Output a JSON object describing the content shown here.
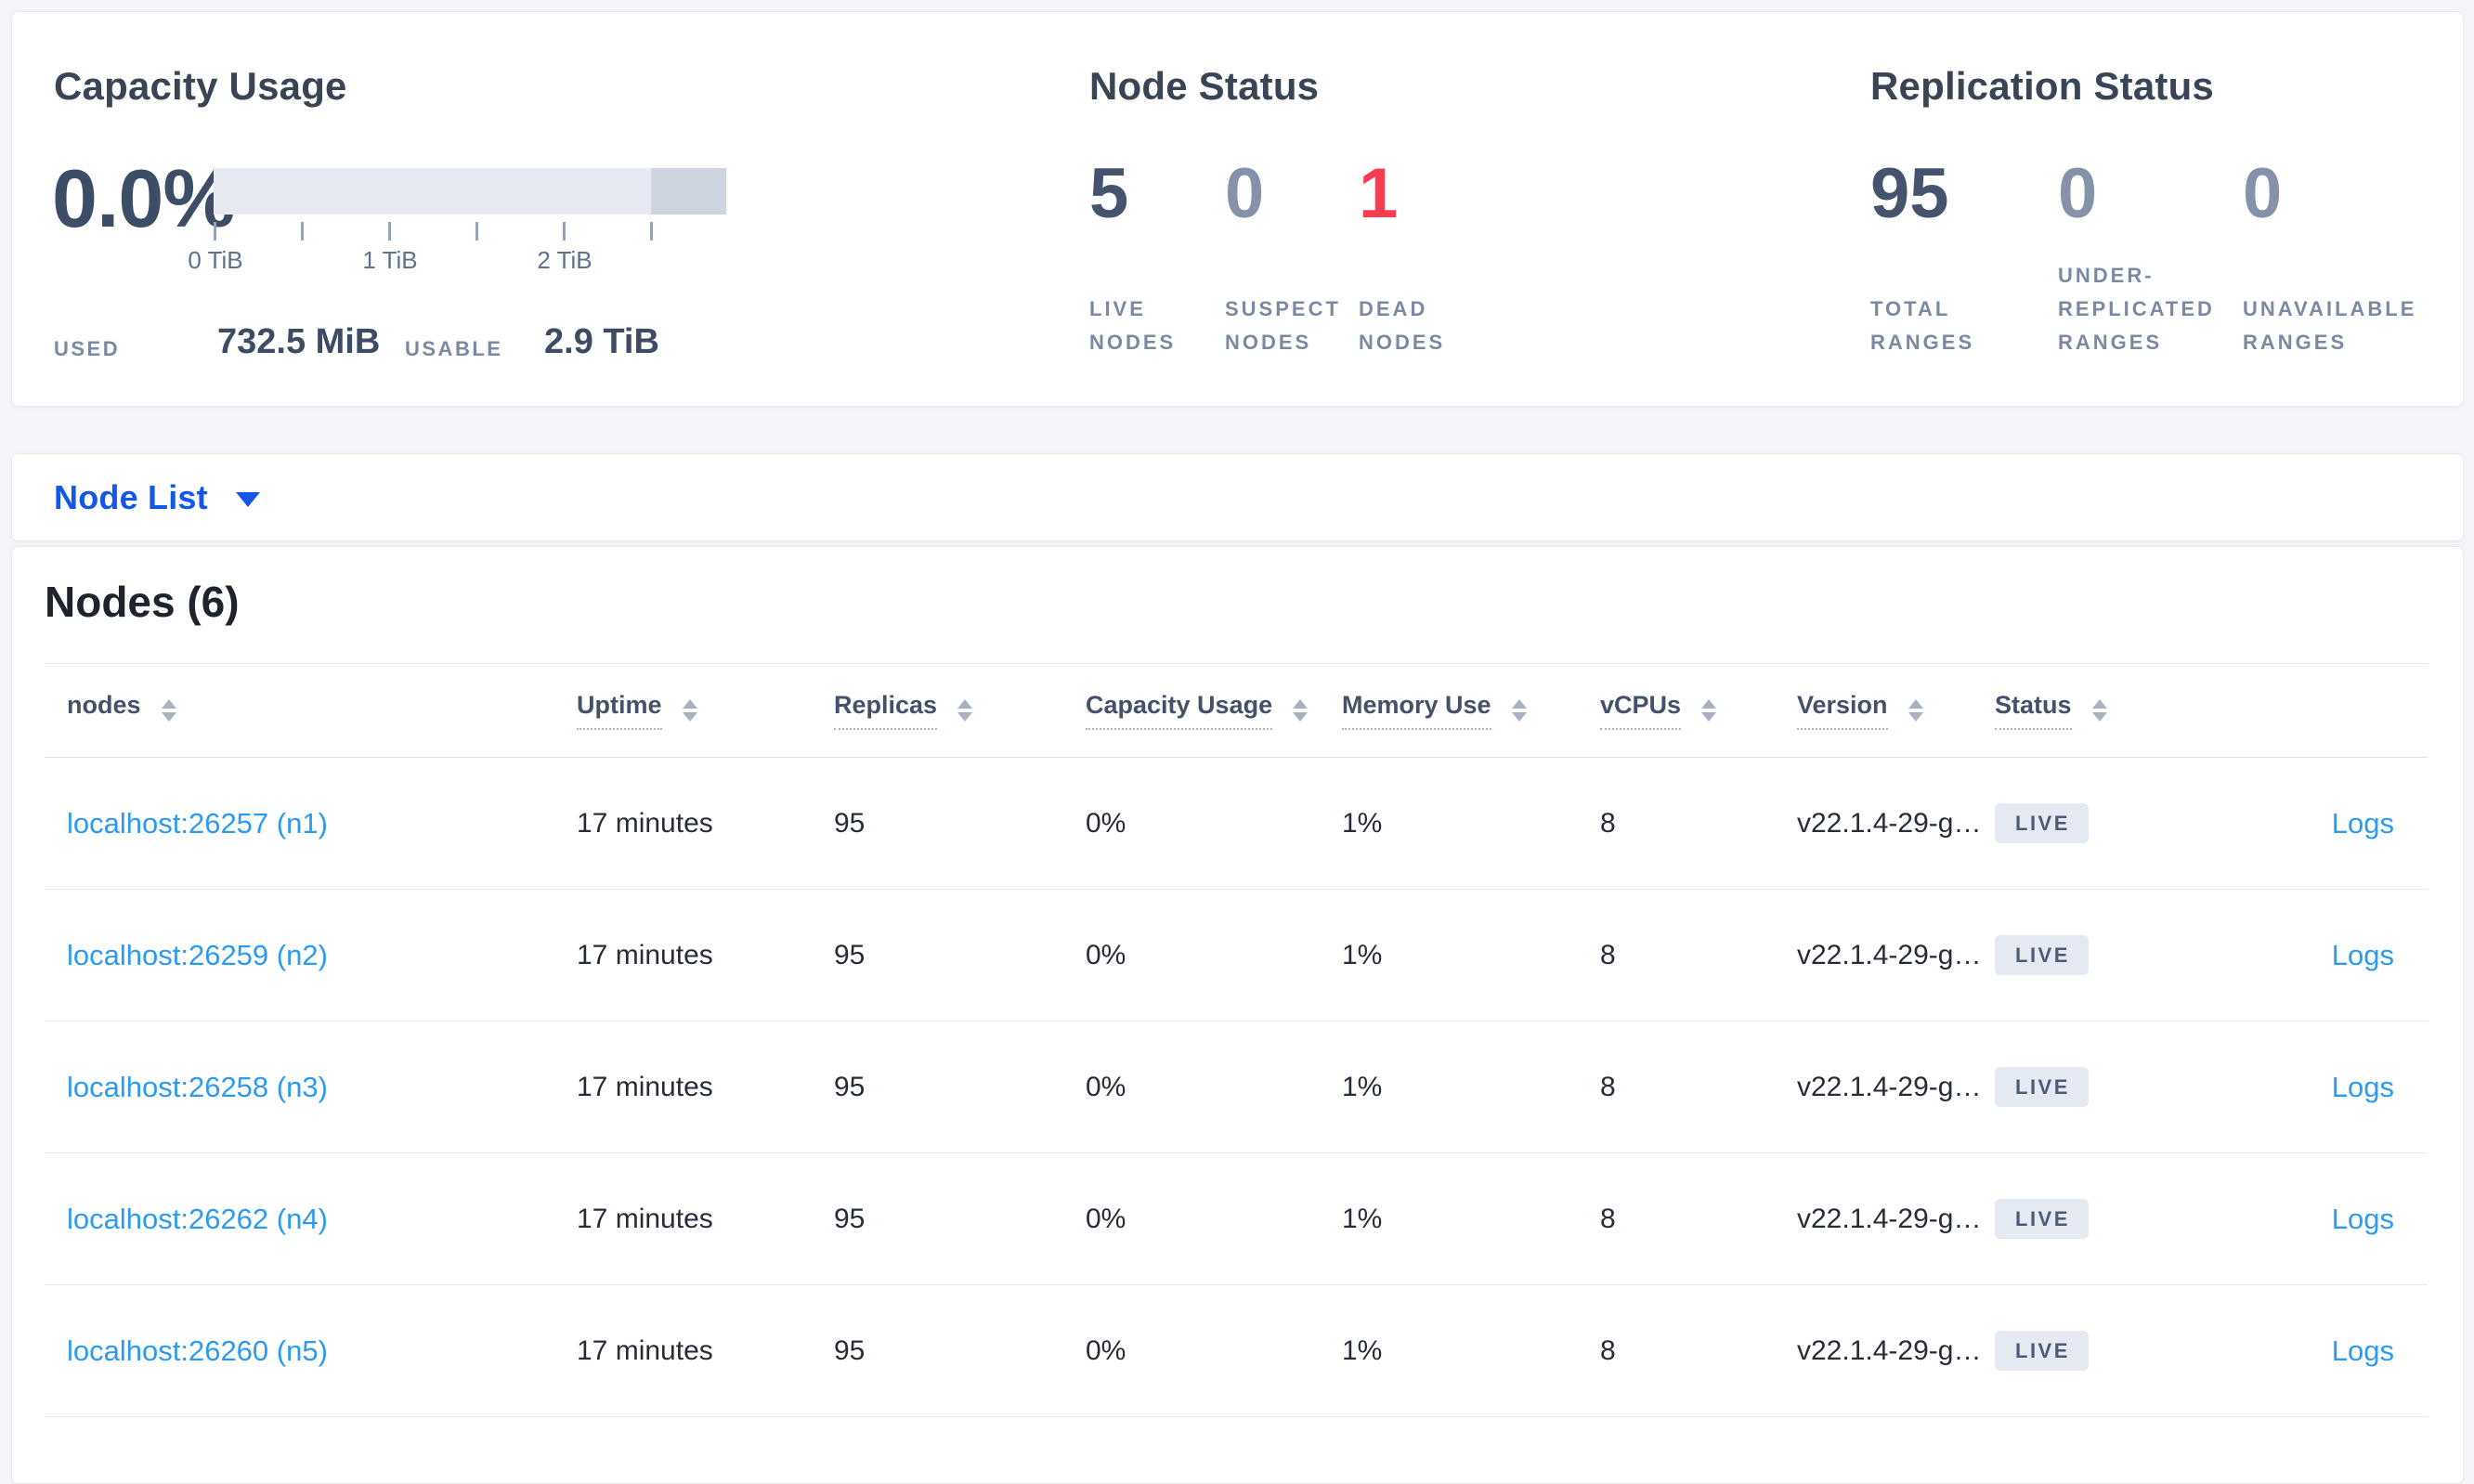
{
  "capacity": {
    "title": "Capacity Usage",
    "percent": "0.0%",
    "ticks": [
      "0 TiB",
      "1 TiB",
      "2 TiB"
    ],
    "used_label": "USED",
    "used_value": "732.5 MiB",
    "usable_label": "USABLE",
    "usable_value": "2.9 TiB"
  },
  "node_status": {
    "title": "Node Status",
    "stats": [
      {
        "value": "5",
        "label": "LIVE NODES",
        "tone": "dark"
      },
      {
        "value": "0",
        "label": "SUSPECT NODES",
        "tone": "muted"
      },
      {
        "value": "1",
        "label": "DEAD NODES",
        "tone": "red"
      }
    ]
  },
  "replication_status": {
    "title": "Replication Status",
    "stats": [
      {
        "value": "95",
        "label": "TOTAL RANGES",
        "tone": "dark"
      },
      {
        "value": "0",
        "label": "UNDER-REPLICATED RANGES",
        "tone": "muted"
      },
      {
        "value": "0",
        "label": "UNAVAILABLE RANGES",
        "tone": "muted"
      }
    ]
  },
  "view_selector": {
    "label": "Node List"
  },
  "nodes_section": {
    "title": "Nodes (6)",
    "columns": [
      {
        "label": "nodes",
        "underline": false
      },
      {
        "label": "Uptime",
        "underline": true
      },
      {
        "label": "Replicas",
        "underline": true
      },
      {
        "label": "Capacity Usage",
        "underline": true
      },
      {
        "label": "Memory Use",
        "underline": true
      },
      {
        "label": "vCPUs",
        "underline": true
      },
      {
        "label": "Version",
        "underline": true
      },
      {
        "label": "Status",
        "underline": true
      }
    ],
    "rows": [
      {
        "name": "localhost:26257 (n1)",
        "uptime": "17 minutes",
        "replicas": "95",
        "capacity": "0%",
        "memory": "1%",
        "vcpus": "8",
        "version": "v22.1.4-29-g…",
        "status": "LIVE",
        "logs": "Logs"
      },
      {
        "name": "localhost:26259 (n2)",
        "uptime": "17 minutes",
        "replicas": "95",
        "capacity": "0%",
        "memory": "1%",
        "vcpus": "8",
        "version": "v22.1.4-29-g…",
        "status": "LIVE",
        "logs": "Logs"
      },
      {
        "name": "localhost:26258 (n3)",
        "uptime": "17 minutes",
        "replicas": "95",
        "capacity": "0%",
        "memory": "1%",
        "vcpus": "8",
        "version": "v22.1.4-29-g…",
        "status": "LIVE",
        "logs": "Logs"
      },
      {
        "name": "localhost:26262 (n4)",
        "uptime": "17 minutes",
        "replicas": "95",
        "capacity": "0%",
        "memory": "1%",
        "vcpus": "8",
        "version": "v22.1.4-29-g…",
        "status": "LIVE",
        "logs": "Logs"
      },
      {
        "name": "localhost:26260 (n5)",
        "uptime": "17 minutes",
        "replicas": "95",
        "capacity": "0%",
        "memory": "1%",
        "vcpus": "8",
        "version": "v22.1.4-29-g…",
        "status": "LIVE",
        "logs": "Logs"
      }
    ]
  },
  "colors": {
    "selector_blue": "#1257ea",
    "link_blue": "#2b9af2",
    "stat_dark": "#46536c",
    "stat_muted": "#8692aa",
    "stat_red": "#fa3c52",
    "badge_bg": "#e5e9f1",
    "bar_track": "#e7eaf2",
    "bar_tail": "#ced4e0",
    "page_bg": "#f4f5f9"
  }
}
